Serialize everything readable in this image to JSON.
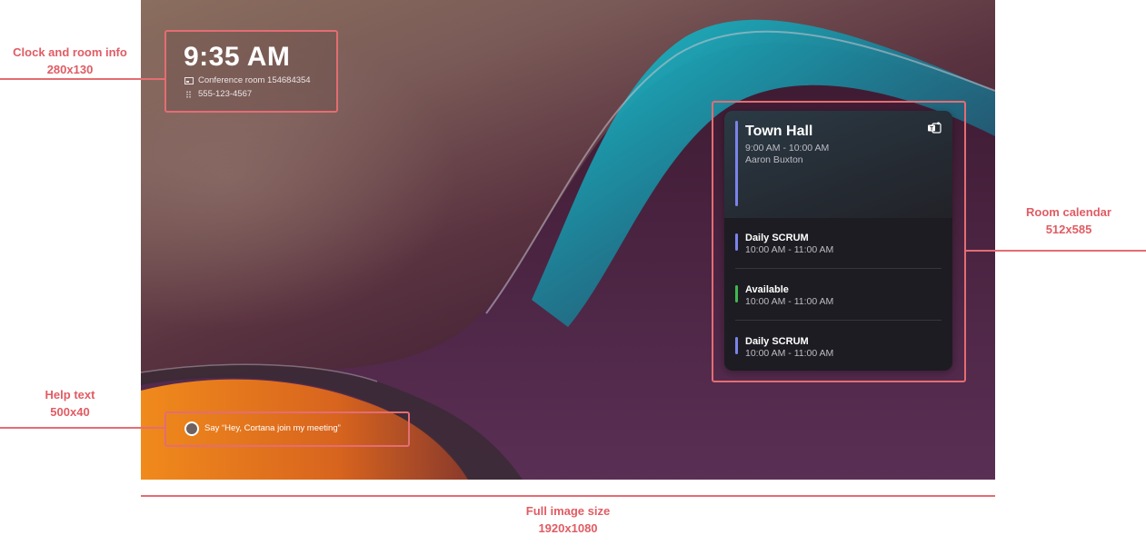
{
  "clock": {
    "time": "9:35 AM",
    "room_name": "Conference room 154684354",
    "phone": "555-123-4567",
    "room_icon": "screen-icon",
    "phone_icon": "dialpad-icon"
  },
  "calendar": {
    "app_icon": "teams-icon",
    "current": {
      "title": "Town Hall",
      "time": "9:00 AM - 10:00 AM",
      "organizer": "Aaron Buxton",
      "accent": "#7b83eb"
    },
    "items": [
      {
        "title": "Daily SCRUM",
        "time": "10:00 AM - 11:00 AM",
        "accent": "#7b83eb"
      },
      {
        "title": "Available",
        "time": "10:00 AM - 11:00 AM",
        "accent": "#3fb94f"
      },
      {
        "title": "Daily SCRUM",
        "time": "10:00 AM - 11:00 AM",
        "accent": "#7b83eb"
      }
    ]
  },
  "help": {
    "text": "Say “Hey, Cortana join my meeting”",
    "icon": "cortana-icon"
  },
  "annotations": {
    "clock_label": "Clock and room info",
    "clock_size": "280x130",
    "calendar_label": "Room calendar",
    "calendar_size": "512x585",
    "help_label": "Help text",
    "help_size": "500x40",
    "full_label": "Full image size",
    "full_size": "1920x1080",
    "color": "#e46d72"
  }
}
